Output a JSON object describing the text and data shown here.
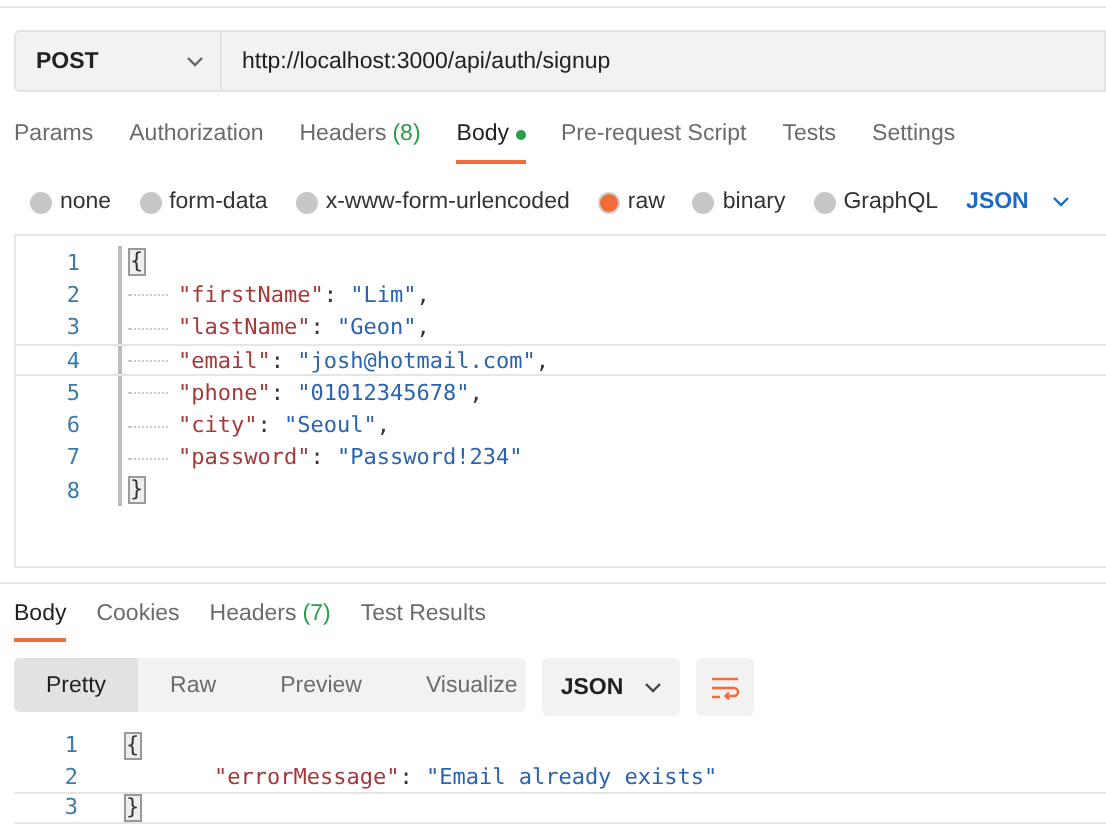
{
  "request": {
    "method": "POST",
    "url": "http://localhost:3000/api/auth/signup"
  },
  "request_tabs": [
    {
      "label": "Params",
      "selected": false,
      "indicator": false
    },
    {
      "label": "Authorization",
      "selected": false,
      "indicator": false
    },
    {
      "label": "Headers",
      "count": "(8)",
      "selected": false,
      "indicator": false
    },
    {
      "label": "Body",
      "selected": true,
      "indicator": true
    },
    {
      "label": "Pre-request Script",
      "selected": false,
      "indicator": false
    },
    {
      "label": "Tests",
      "selected": false,
      "indicator": false
    },
    {
      "label": "Settings",
      "selected": false,
      "indicator": false
    }
  ],
  "body_types": [
    {
      "label": "none",
      "selected": false
    },
    {
      "label": "form-data",
      "selected": false
    },
    {
      "label": "x-www-form-urlencoded",
      "selected": false
    },
    {
      "label": "raw",
      "selected": true
    },
    {
      "label": "binary",
      "selected": false
    },
    {
      "label": "GraphQL",
      "selected": false
    }
  ],
  "body_format": "JSON",
  "request_body": [
    {
      "number": "1",
      "indent": false,
      "active": false,
      "tokens": [
        {
          "kind": "brace",
          "text": "{"
        }
      ]
    },
    {
      "number": "2",
      "indent": true,
      "active": false,
      "tokens": [
        {
          "kind": "key",
          "text": "\"firstName\""
        },
        {
          "kind": "punct",
          "text": ": "
        },
        {
          "kind": "string",
          "text": "\"Lim\""
        },
        {
          "kind": "punct",
          "text": ","
        }
      ]
    },
    {
      "number": "3",
      "indent": true,
      "active": false,
      "tokens": [
        {
          "kind": "key",
          "text": "\"lastName\""
        },
        {
          "kind": "punct",
          "text": ": "
        },
        {
          "kind": "string",
          "text": "\"Geon\""
        },
        {
          "kind": "punct",
          "text": ","
        }
      ]
    },
    {
      "number": "4",
      "indent": true,
      "active": true,
      "tokens": [
        {
          "kind": "key",
          "text": "\"email\""
        },
        {
          "kind": "punct",
          "text": ": "
        },
        {
          "kind": "string",
          "text": "\"josh@hotmail.com\""
        },
        {
          "kind": "punct",
          "text": ","
        }
      ]
    },
    {
      "number": "5",
      "indent": true,
      "active": false,
      "tokens": [
        {
          "kind": "key",
          "text": "\"phone\""
        },
        {
          "kind": "punct",
          "text": ": "
        },
        {
          "kind": "string",
          "text": "\"01012345678\""
        },
        {
          "kind": "punct",
          "text": ","
        }
      ]
    },
    {
      "number": "6",
      "indent": true,
      "active": false,
      "tokens": [
        {
          "kind": "key",
          "text": "\"city\""
        },
        {
          "kind": "punct",
          "text": ": "
        },
        {
          "kind": "string",
          "text": "\"Seoul\""
        },
        {
          "kind": "punct",
          "text": ","
        }
      ]
    },
    {
      "number": "7",
      "indent": true,
      "active": false,
      "tokens": [
        {
          "kind": "key",
          "text": "\"password\""
        },
        {
          "kind": "punct",
          "text": ": "
        },
        {
          "kind": "string",
          "text": "\"Password!234\""
        }
      ]
    },
    {
      "number": "8",
      "indent": false,
      "active": false,
      "tokens": [
        {
          "kind": "brace",
          "text": "}"
        }
      ]
    }
  ],
  "response_tabs": [
    {
      "label": "Body",
      "selected": true
    },
    {
      "label": "Cookies",
      "selected": false
    },
    {
      "label": "Headers",
      "count": "(7)",
      "selected": false
    },
    {
      "label": "Test Results",
      "selected": false
    }
  ],
  "view_modes": [
    {
      "label": "Pretty",
      "selected": true
    },
    {
      "label": "Raw",
      "selected": false
    },
    {
      "label": "Preview",
      "selected": false
    },
    {
      "label": "Visualize",
      "selected": false
    }
  ],
  "response_format": "JSON",
  "response_body": [
    {
      "number": "1",
      "indent": false,
      "active": false,
      "tokens": [
        {
          "kind": "brace",
          "text": "{"
        }
      ]
    },
    {
      "number": "2",
      "indent": true,
      "active": false,
      "tokens": [
        {
          "kind": "key",
          "text": "\"errorMessage\""
        },
        {
          "kind": "punct",
          "text": ": "
        },
        {
          "kind": "string",
          "text": "\"Email already exists\""
        }
      ]
    },
    {
      "number": "3",
      "indent": false,
      "active": true,
      "tokens": [
        {
          "kind": "brace",
          "text": "}"
        }
      ]
    }
  ]
}
